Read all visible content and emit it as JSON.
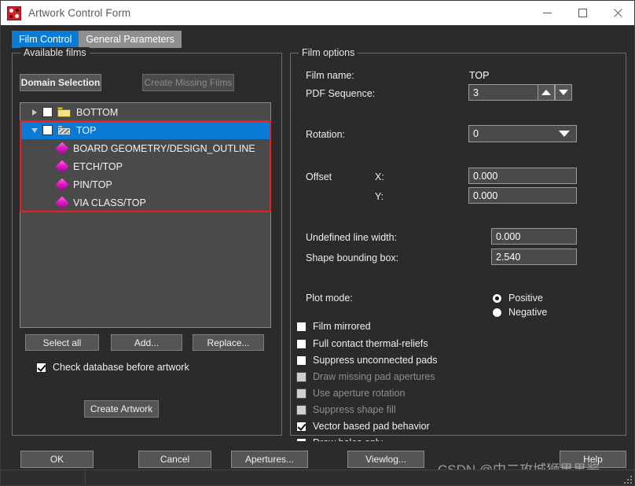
{
  "window": {
    "title": "Artwork Control Form",
    "app_icon": "artwork-app-icon",
    "minimize_label": "Minimize",
    "maximize_label": "Maximize",
    "close_label": "Close"
  },
  "tabs": [
    {
      "label": "Film Control",
      "active": true
    },
    {
      "label": "General Parameters",
      "active": false
    }
  ],
  "films_group": {
    "legend": "Available films",
    "domain_selection_label": "Domain Selection",
    "create_missing_films_label": "Create Missing Films",
    "select_all_label": "Select all",
    "add_label": "Add...",
    "replace_label": "Replace...",
    "check_database_label": "Check database before artwork",
    "check_database_checked": true,
    "create_artwork_label": "Create Artwork",
    "tree": [
      {
        "label": "BOTTOM",
        "level": 0,
        "expanded": false,
        "checked": false,
        "selected": false,
        "icon": "folder-closed-icon"
      },
      {
        "label": "TOP",
        "level": 0,
        "expanded": true,
        "checked": false,
        "selected": true,
        "icon": "folder-open-icon"
      },
      {
        "label": "BOARD GEOMETRY/DESIGN_OUTLINE",
        "level": 1,
        "icon": "layer-diamond-icon"
      },
      {
        "label": "ETCH/TOP",
        "level": 1,
        "icon": "layer-diamond-icon"
      },
      {
        "label": "PIN/TOP",
        "level": 1,
        "icon": "layer-diamond-icon"
      },
      {
        "label": "VIA CLASS/TOP",
        "level": 1,
        "icon": "layer-diamond-icon"
      }
    ]
  },
  "options_group": {
    "legend": "Film options",
    "film_name_label": "Film name:",
    "film_name_value": "TOP",
    "pdf_sequence_label": "PDF Sequence:",
    "pdf_sequence_value": "3",
    "rotation_label": "Rotation:",
    "rotation_value": "0",
    "offset_label": "Offset",
    "offset_x_label": "X:",
    "offset_x_value": "0.000",
    "offset_y_label": "Y:",
    "offset_y_value": "0.000",
    "undefined_line_width_label": "Undefined line width:",
    "undefined_line_width_value": "0.000",
    "shape_bounding_box_label": "Shape bounding box:",
    "shape_bounding_box_value": "2.540",
    "plot_mode_label": "Plot mode:",
    "plot_mode_options": [
      {
        "label": "Positive",
        "selected": true
      },
      {
        "label": "Negative",
        "selected": false
      }
    ],
    "checkboxes": [
      {
        "label": "Film mirrored",
        "checked": false,
        "disabled": false
      },
      {
        "label": "Full contact thermal-reliefs",
        "checked": false,
        "disabled": false
      },
      {
        "label": "Suppress unconnected pads",
        "checked": false,
        "disabled": false
      },
      {
        "label": "Draw missing pad apertures",
        "checked": false,
        "disabled": true
      },
      {
        "label": "Use aperture rotation",
        "checked": false,
        "disabled": true
      },
      {
        "label": "Suppress shape fill",
        "checked": false,
        "disabled": true
      },
      {
        "label": "Vector based pad behavior",
        "checked": true,
        "disabled": false
      },
      {
        "label": "Draw holes only",
        "checked": false,
        "disabled": false
      }
    ]
  },
  "action_buttons": [
    {
      "label": "OK"
    },
    {
      "label": "Cancel"
    },
    {
      "label": "Apertures..."
    },
    {
      "label": "Viewlog..."
    },
    {
      "label": "Help"
    }
  ],
  "watermark": "CSDN @中二攻城狮果果酱",
  "colors": {
    "accent": "#0a7bd4",
    "annotation": "#ee1c1c",
    "window_bg": "#2b2b2b",
    "field_bg": "#4a4a4a",
    "layer_icon": "#e317c8"
  }
}
